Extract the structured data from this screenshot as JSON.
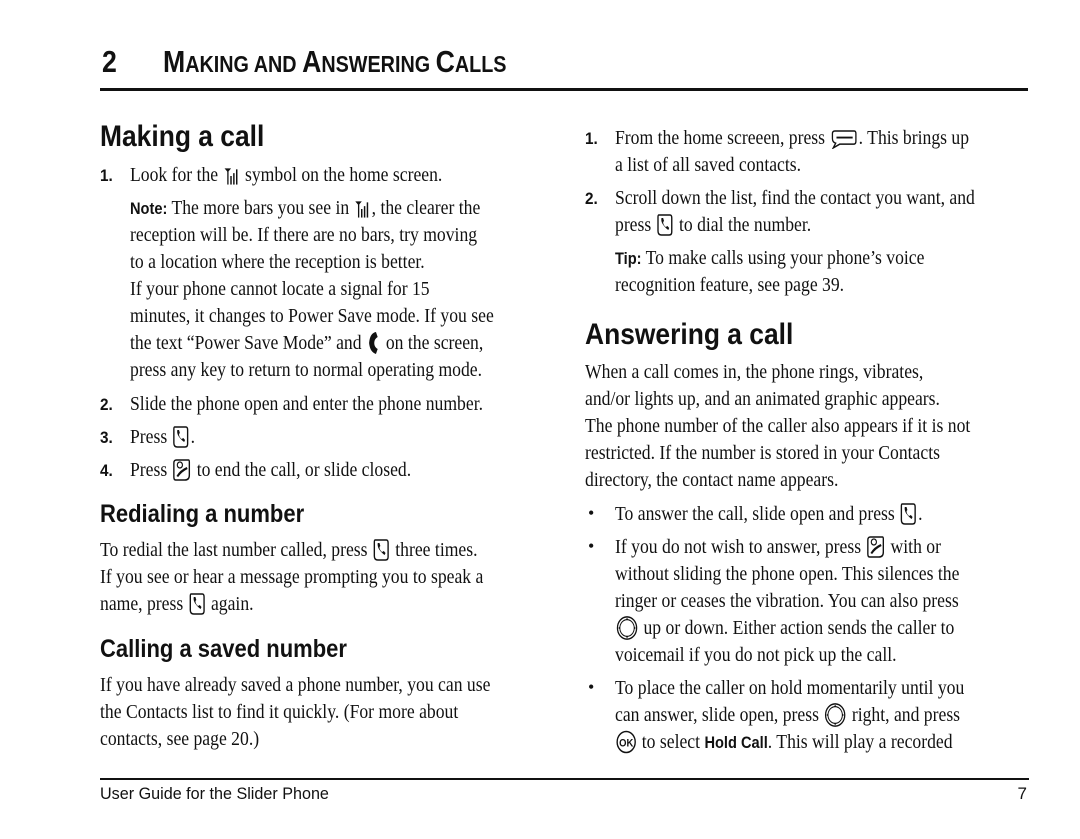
{
  "chapter": {
    "number": "2",
    "title_parts": [
      {
        "big": "M",
        "small": "AKING AND "
      },
      {
        "big": "A",
        "small": "NSWERING "
      },
      {
        "big": "C",
        "small": "ALLS"
      }
    ]
  },
  "making_a_call": {
    "heading": "Making a call",
    "step1": {
      "num": "1.",
      "a": "Look for the ",
      "icon": "signal-strength-icon",
      "b": " symbol on the home screen."
    },
    "note": {
      "label": "Note:",
      "l1a": " The more bars you see in ",
      "l1b": ", the clearer the",
      "l2": "reception will be. If there are no bars, try moving",
      "l3": "to a location where the reception is better.",
      "l4": "If your phone cannot locate a signal for 15",
      "l5": "minutes, it changes to Power Save mode. If you see",
      "l6a": "the text “Power Save Mode” and ",
      "l6b": " on the screen,",
      "l7": "press any key to return to normal operating mode."
    },
    "step2": {
      "num": "2.",
      "text": "Slide the phone open and enter the phone number."
    },
    "step3": {
      "num": "3.",
      "a": "Press ",
      "b": "."
    },
    "step4": {
      "num": "4.",
      "a": "Press ",
      "b": " to end the call, or slide closed."
    }
  },
  "redialing": {
    "heading": "Redialing a number",
    "l1a": "To redial the last number called, press ",
    "l1b": " three times.",
    "l2": "If you see or hear a message prompting you to speak a",
    "l3a": "name, press ",
    "l3b": " again."
  },
  "calling_saved": {
    "heading": "Calling a saved number",
    "l1": "If you have already saved a phone number, you can use",
    "l2": "the Contacts list to find it quickly. (For more about",
    "l3": "contacts, see page 20.)"
  },
  "saved_steps": {
    "step1": {
      "num": "1.",
      "a": "From the home screeen, press ",
      "b": ". This brings up",
      "c": "a list of all saved contacts."
    },
    "step2": {
      "num": "2.",
      "a": "Scroll down the list, find the contact you want, and",
      "b": "press ",
      "c": " to dial the number."
    },
    "tip": {
      "label": "Tip:",
      "l1": " To make calls using your phone’s voice",
      "l2": "recognition feature, see page 39."
    }
  },
  "answering": {
    "heading": "Answering a call",
    "p1": "When a call comes in, the phone rings, vibrates,",
    "p2": "and/or lights up, and an animated graphic appears.",
    "p3": "The phone number of the caller also appears if it is not",
    "p4": "restricted. If the number is stored in your Contacts",
    "p5": "directory, the contact name appears.",
    "bullet_char": "•",
    "b1a": "To answer the call, slide open and press ",
    "b1b": ".",
    "b2a": "If you do not wish to answer, press ",
    "b2b": " with or",
    "b2c": "without sliding the phone open. This silences the",
    "b2d": "ringer or ceases the vibration. You can also press",
    "b2e": " up or down. Either action sends the caller to",
    "b2f": "voicemail if you do not pick up the call.",
    "b3a": "To place the caller on hold momentarily until you",
    "b3b": "can answer, slide open, press ",
    "b3c": " right, and press",
    "b3d": " to select ",
    "b3e": "Hold Call",
    "b3f": ". This will play a recorded"
  },
  "footer": {
    "title": "User Guide for the Slider Phone",
    "page": "7"
  }
}
